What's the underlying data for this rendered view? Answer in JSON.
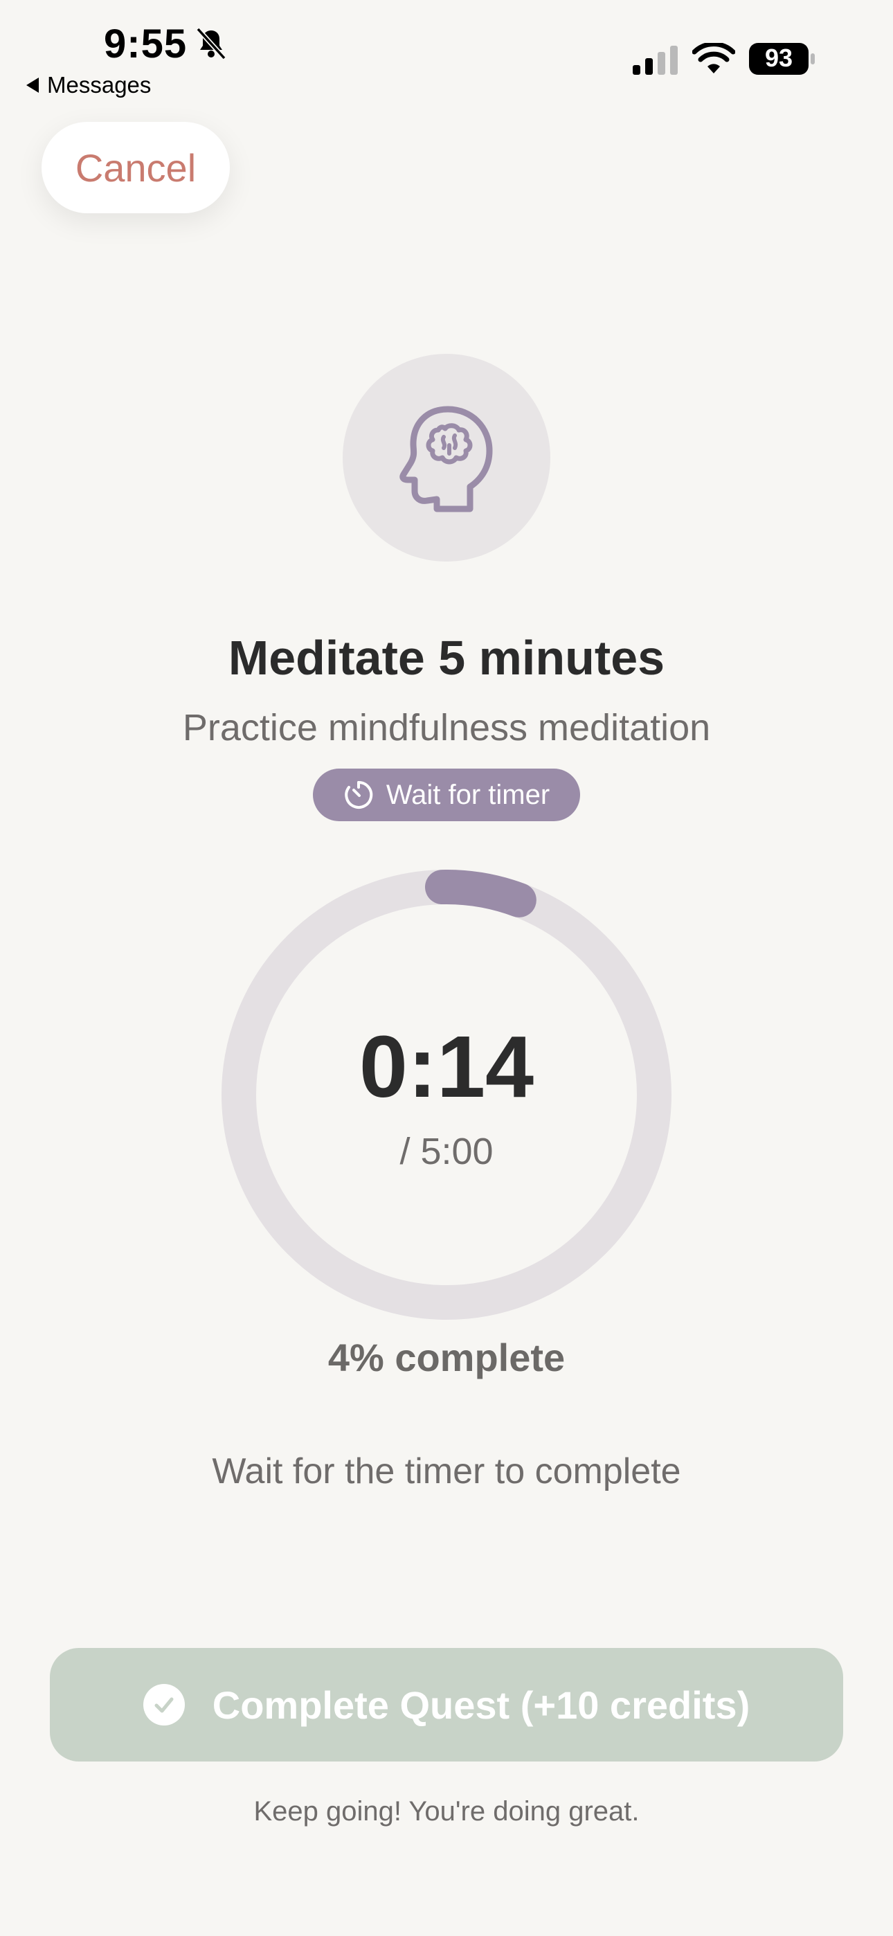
{
  "status_bar": {
    "time": "9:55",
    "back_label": "Messages",
    "battery": "93"
  },
  "header": {
    "cancel_label": "Cancel"
  },
  "quest": {
    "icon": "brain-head-icon",
    "title": "Meditate 5 minutes",
    "subtitle": "Practice mindfulness meditation",
    "badge_label": "Wait for timer"
  },
  "timer": {
    "elapsed": "0:14",
    "total": "/ 5:00",
    "progress_fraction": 0.04,
    "percent_label": "4% complete",
    "hint": "Wait for the timer to complete"
  },
  "action": {
    "complete_label": "Complete Quest (+10 credits)",
    "footer": "Keep going! You're doing great."
  },
  "colors": {
    "background": "#f7f6f3",
    "accent_purple": "#9a8ca8",
    "cancel_text": "#c97b6f",
    "button_disabled_green": "#c8d3c8",
    "ring_track": "#e4e0e3"
  }
}
